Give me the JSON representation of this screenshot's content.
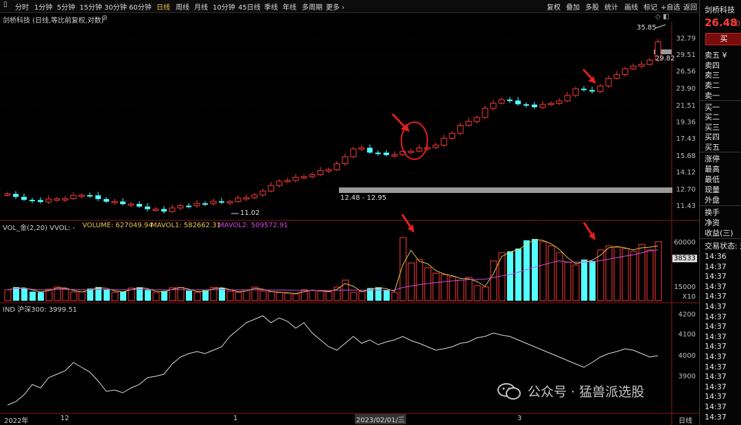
{
  "toolbar": {
    "periods": [
      "分时",
      "1分钟",
      "5分钟",
      "15分钟",
      "30分钟",
      "60分钟",
      "日线",
      "周线",
      "月线",
      "10分钟",
      "45日线",
      "季线",
      "年线",
      "多周期",
      "更多 ›"
    ],
    "active_period": "日线",
    "right_buttons": [
      "复权",
      "叠加",
      "多股",
      "统计",
      "画线",
      "标记",
      "+自选",
      "返回"
    ]
  },
  "stock": {
    "name": "剑桥科技",
    "chart_title": "剑桥科技 (日线,等比前复权,对数)",
    "price": "26.48",
    "change_partial": "0.",
    "sell_button": "买"
  },
  "order_book": {
    "sell": [
      "卖五 ¥",
      "卖四",
      "卖三",
      "卖二",
      "卖一"
    ],
    "buy": [
      "买一",
      "买二",
      "买三",
      "买四",
      "买五"
    ],
    "stats": [
      "涨停",
      "最高",
      "最低",
      "现量",
      "外盘"
    ],
    "extra": [
      "换手",
      "净资",
      "收益(三)",
      "交易状态: 连"
    ],
    "times": [
      "14:36",
      "14:37",
      "14:37",
      "14:37",
      "14:37",
      "14:37",
      "14:37",
      "14:37",
      "14:37",
      "14:37",
      "14:37",
      "14:37",
      "14:37",
      "14:37",
      "14:37",
      "14:37",
      "14:37"
    ]
  },
  "price_panel": {
    "axis": [
      "32.79",
      "29.51",
      "26.56",
      "23.90",
      "21.51",
      "19.36",
      "17.43",
      "15.68",
      "14.12",
      "12.70",
      "11.43"
    ],
    "high_label": "35.85",
    "low_label": "11.02",
    "current_marker": "29.82",
    "range_label": "12.48 - 12.95"
  },
  "volume_panel": {
    "header_prefix": "VOL_金(2,20)  VVOL: -",
    "volume": "VOLUME: 627049.94",
    "mavol1": "MAVOL1: 582662.31",
    "mavol2": "MAVOL2: 509572.91",
    "axis": [
      "60000",
      "15000",
      "X10"
    ],
    "current": "38533",
    "colors": {
      "volume": "#e6c84d",
      "mavol1": "#e6c84d",
      "mavol2": "#d04de0"
    }
  },
  "ind_panel": {
    "header": "IND 沪深300: 3999.51",
    "axis": [
      "4200",
      "4100",
      "4000",
      "3900"
    ]
  },
  "xaxis": {
    "labels": [
      "2022年",
      "12",
      "1",
      "2023/02/01/三",
      "3"
    ],
    "period_label": "日线"
  },
  "watermark": "公众号 · 猛兽派选股",
  "colors": {
    "up": "#ff3b3b",
    "down": "#54ffff",
    "axis_red": "#8b1a1a",
    "ma_yellow": "#e6c84d",
    "ma_purple": "#d04de0"
  }
}
